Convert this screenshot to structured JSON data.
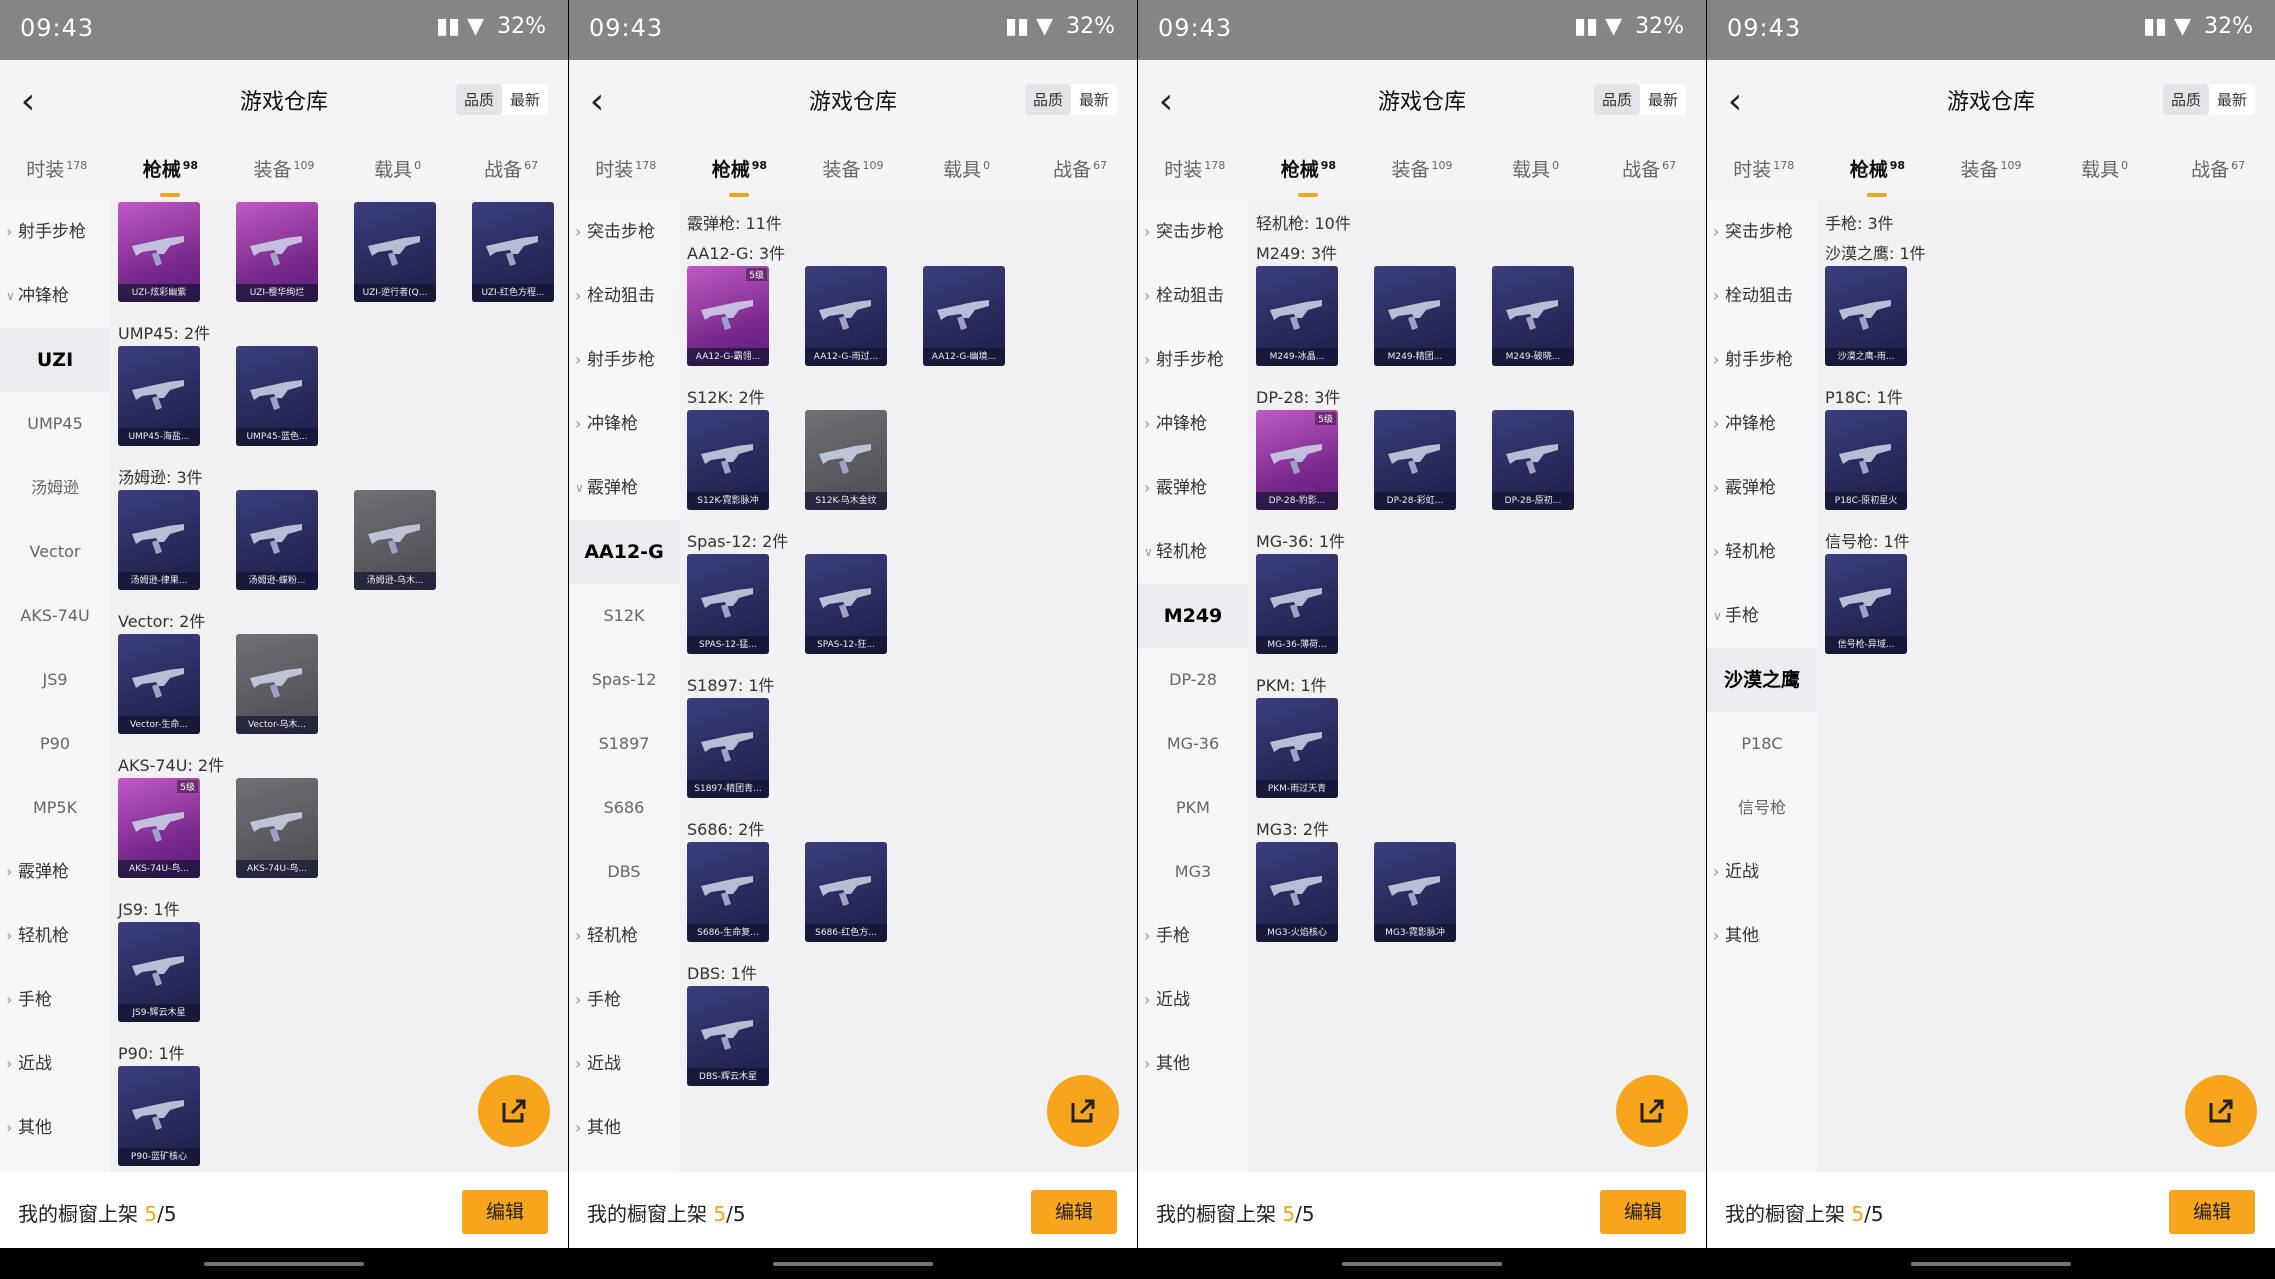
{
  "status": {
    "time": "09:43",
    "battery": "32%"
  },
  "header": {
    "title": "游戏仓库",
    "sort": [
      "品质",
      "最新"
    ]
  },
  "tabs": [
    {
      "label": "时装",
      "count": "178"
    },
    {
      "label": "枪械",
      "count": "98"
    },
    {
      "label": "装备",
      "count": "109"
    },
    {
      "label": "载具",
      "count": "0"
    },
    {
      "label": "战备",
      "count": "67"
    }
  ],
  "bottom": {
    "label": "我的橱窗上架",
    "count": "5",
    "total": "/5",
    "edit": "编辑"
  },
  "colors": {
    "accent": "#f6a51c",
    "card": "#2b2c63",
    "card_pink": "#a03ab0"
  },
  "panels": [
    {
      "sidebar": [
        {
          "label": "射手步枪",
          "kind": "cat"
        },
        {
          "label": "冲锋枪",
          "kind": "cat-open"
        },
        {
          "label": "UZI",
          "kind": "sub-active"
        },
        {
          "label": "UMP45",
          "kind": "sub"
        },
        {
          "label": "汤姆逊",
          "kind": "sub"
        },
        {
          "label": "Vector",
          "kind": "sub"
        },
        {
          "label": "AKS-74U",
          "kind": "sub"
        },
        {
          "label": "JS9",
          "kind": "sub"
        },
        {
          "label": "P90",
          "kind": "sub"
        },
        {
          "label": "MP5K",
          "kind": "sub"
        },
        {
          "label": "霰弹枪",
          "kind": "cat"
        },
        {
          "label": "轻机枪",
          "kind": "cat"
        },
        {
          "label": "手枪",
          "kind": "cat"
        },
        {
          "label": "近战",
          "kind": "cat"
        },
        {
          "label": "其他",
          "kind": "cat"
        }
      ],
      "groups": [
        {
          "heading": "",
          "items": [
            {
              "label": "UZI-炫彩幽紫",
              "style": "pink"
            },
            {
              "label": "UZI-樱华绚烂",
              "style": "pink"
            },
            {
              "label": "UZI-逆行者(Q...",
              "style": "normal"
            },
            {
              "label": "UZI-红色方程...",
              "style": "normal"
            }
          ]
        },
        {
          "heading": "UMP45: 2件",
          "items": [
            {
              "label": "UMP45-海盐...",
              "style": "normal"
            },
            {
              "label": "UMP45-蓝色...",
              "style": "normal"
            }
          ]
        },
        {
          "heading": "汤姆逊: 3件",
          "items": [
            {
              "label": "汤姆逊-律果...",
              "style": "normal"
            },
            {
              "label": "汤姆逊-蝶粉...",
              "style": "normal"
            },
            {
              "label": "汤姆逊-乌木...",
              "style": "gray"
            }
          ]
        },
        {
          "heading": "Vector: 2件",
          "items": [
            {
              "label": "Vector-生命...",
              "style": "normal"
            },
            {
              "label": "Vector-乌木...",
              "style": "gray"
            }
          ]
        },
        {
          "heading": "AKS-74U: 2件",
          "items": [
            {
              "label": "AKS-74U-鸟...",
              "style": "pink",
              "badge": "5级"
            },
            {
              "label": "AKS-74U-鸟...",
              "style": "gray"
            }
          ]
        },
        {
          "heading": "JS9: 1件",
          "items": [
            {
              "label": "JS9-辉云木星",
              "style": "normal"
            }
          ]
        },
        {
          "heading": "P90: 1件",
          "items": [
            {
              "label": "P90-蓝矿核心",
              "style": "normal"
            }
          ]
        }
      ]
    },
    {
      "sidebar": [
        {
          "label": "突击步枪",
          "kind": "cat"
        },
        {
          "label": "栓动狙击",
          "kind": "cat"
        },
        {
          "label": "射手步枪",
          "kind": "cat"
        },
        {
          "label": "冲锋枪",
          "kind": "cat"
        },
        {
          "label": "霰弹枪",
          "kind": "cat-open"
        },
        {
          "label": "AA12-G",
          "kind": "sub-active"
        },
        {
          "label": "S12K",
          "kind": "sub"
        },
        {
          "label": "Spas-12",
          "kind": "sub"
        },
        {
          "label": "S1897",
          "kind": "sub"
        },
        {
          "label": "S686",
          "kind": "sub"
        },
        {
          "label": "DBS",
          "kind": "sub"
        },
        {
          "label": "轻机枪",
          "kind": "cat"
        },
        {
          "label": "手枪",
          "kind": "cat"
        },
        {
          "label": "近战",
          "kind": "cat"
        },
        {
          "label": "其他",
          "kind": "cat"
        }
      ],
      "summary": "霰弹枪: 11件",
      "groups": [
        {
          "heading": "AA12-G: 3件",
          "items": [
            {
              "label": "AA12-G-霸翎...",
              "style": "pink",
              "badge": "5级"
            },
            {
              "label": "AA12-G-雨过...",
              "style": "normal"
            },
            {
              "label": "AA12-G-幽境...",
              "style": "normal"
            }
          ]
        },
        {
          "heading": "S12K: 2件",
          "items": [
            {
              "label": "S12K-霓影脉冲",
              "style": "normal"
            },
            {
              "label": "S12K-乌木金纹",
              "style": "gray"
            }
          ]
        },
        {
          "heading": "Spas-12: 2件",
          "items": [
            {
              "label": "SPAS-12-猛...",
              "style": "normal"
            },
            {
              "label": "SPAS-12-狂...",
              "style": "normal"
            }
          ]
        },
        {
          "heading": "S1897: 1件",
          "items": [
            {
              "label": "S1897-精团青...",
              "style": "normal"
            }
          ]
        },
        {
          "heading": "S686: 2件",
          "items": [
            {
              "label": "S686-生命复...",
              "style": "normal"
            },
            {
              "label": "S686-红色方...",
              "style": "normal"
            }
          ]
        },
        {
          "heading": "DBS: 1件",
          "items": [
            {
              "label": "DBS-辉云木星",
              "style": "normal"
            }
          ]
        }
      ]
    },
    {
      "sidebar": [
        {
          "label": "突击步枪",
          "kind": "cat"
        },
        {
          "label": "栓动狙击",
          "kind": "cat"
        },
        {
          "label": "射手步枪",
          "kind": "cat"
        },
        {
          "label": "冲锋枪",
          "kind": "cat"
        },
        {
          "label": "霰弹枪",
          "kind": "cat"
        },
        {
          "label": "轻机枪",
          "kind": "cat-open"
        },
        {
          "label": "M249",
          "kind": "sub-active"
        },
        {
          "label": "DP-28",
          "kind": "sub"
        },
        {
          "label": "MG-36",
          "kind": "sub"
        },
        {
          "label": "PKM",
          "kind": "sub"
        },
        {
          "label": "MG3",
          "kind": "sub"
        },
        {
          "label": "手枪",
          "kind": "cat"
        },
        {
          "label": "近战",
          "kind": "cat"
        },
        {
          "label": "其他",
          "kind": "cat"
        }
      ],
      "summary": "轻机枪: 10件",
      "groups": [
        {
          "heading": "M249: 3件",
          "items": [
            {
              "label": "M249-冰晶...",
              "style": "normal"
            },
            {
              "label": "M249-精团...",
              "style": "normal"
            },
            {
              "label": "M249-破晓...",
              "style": "normal"
            }
          ]
        },
        {
          "heading": "DP-28: 3件",
          "items": [
            {
              "label": "DP-28-豹影...",
              "style": "pink",
              "badge": "5级"
            },
            {
              "label": "DP-28-彩虹...",
              "style": "normal"
            },
            {
              "label": "DP-28-原初...",
              "style": "normal"
            }
          ]
        },
        {
          "heading": "MG-36: 1件",
          "items": [
            {
              "label": "MG-36-薄荷...",
              "style": "normal"
            }
          ]
        },
        {
          "heading": "PKM: 1件",
          "items": [
            {
              "label": "PKM-雨过天青",
              "style": "normal"
            }
          ]
        },
        {
          "heading": "MG3: 2件",
          "items": [
            {
              "label": "MG3-火焰核心",
              "style": "normal"
            },
            {
              "label": "MG3-霓影脉冲",
              "style": "normal"
            }
          ]
        }
      ]
    },
    {
      "sidebar": [
        {
          "label": "突击步枪",
          "kind": "cat"
        },
        {
          "label": "栓动狙击",
          "kind": "cat"
        },
        {
          "label": "射手步枪",
          "kind": "cat"
        },
        {
          "label": "冲锋枪",
          "kind": "cat"
        },
        {
          "label": "霰弹枪",
          "kind": "cat"
        },
        {
          "label": "轻机枪",
          "kind": "cat"
        },
        {
          "label": "手枪",
          "kind": "cat-open"
        },
        {
          "label": "沙漠之鹰",
          "kind": "sub-active"
        },
        {
          "label": "P18C",
          "kind": "sub"
        },
        {
          "label": "信号枪",
          "kind": "sub"
        },
        {
          "label": "近战",
          "kind": "cat"
        },
        {
          "label": "其他",
          "kind": "cat"
        }
      ],
      "summary": "手枪: 3件",
      "groups": [
        {
          "heading": "沙漠之鹰: 1件",
          "items": [
            {
              "label": "沙漠之鹰-雨...",
              "style": "normal"
            }
          ]
        },
        {
          "heading": "P18C: 1件",
          "items": [
            {
              "label": "P18C-原初星火",
              "style": "normal"
            }
          ]
        },
        {
          "heading": "信号枪: 1件",
          "items": [
            {
              "label": "信号枪-异域...",
              "style": "normal"
            }
          ]
        }
      ]
    }
  ]
}
